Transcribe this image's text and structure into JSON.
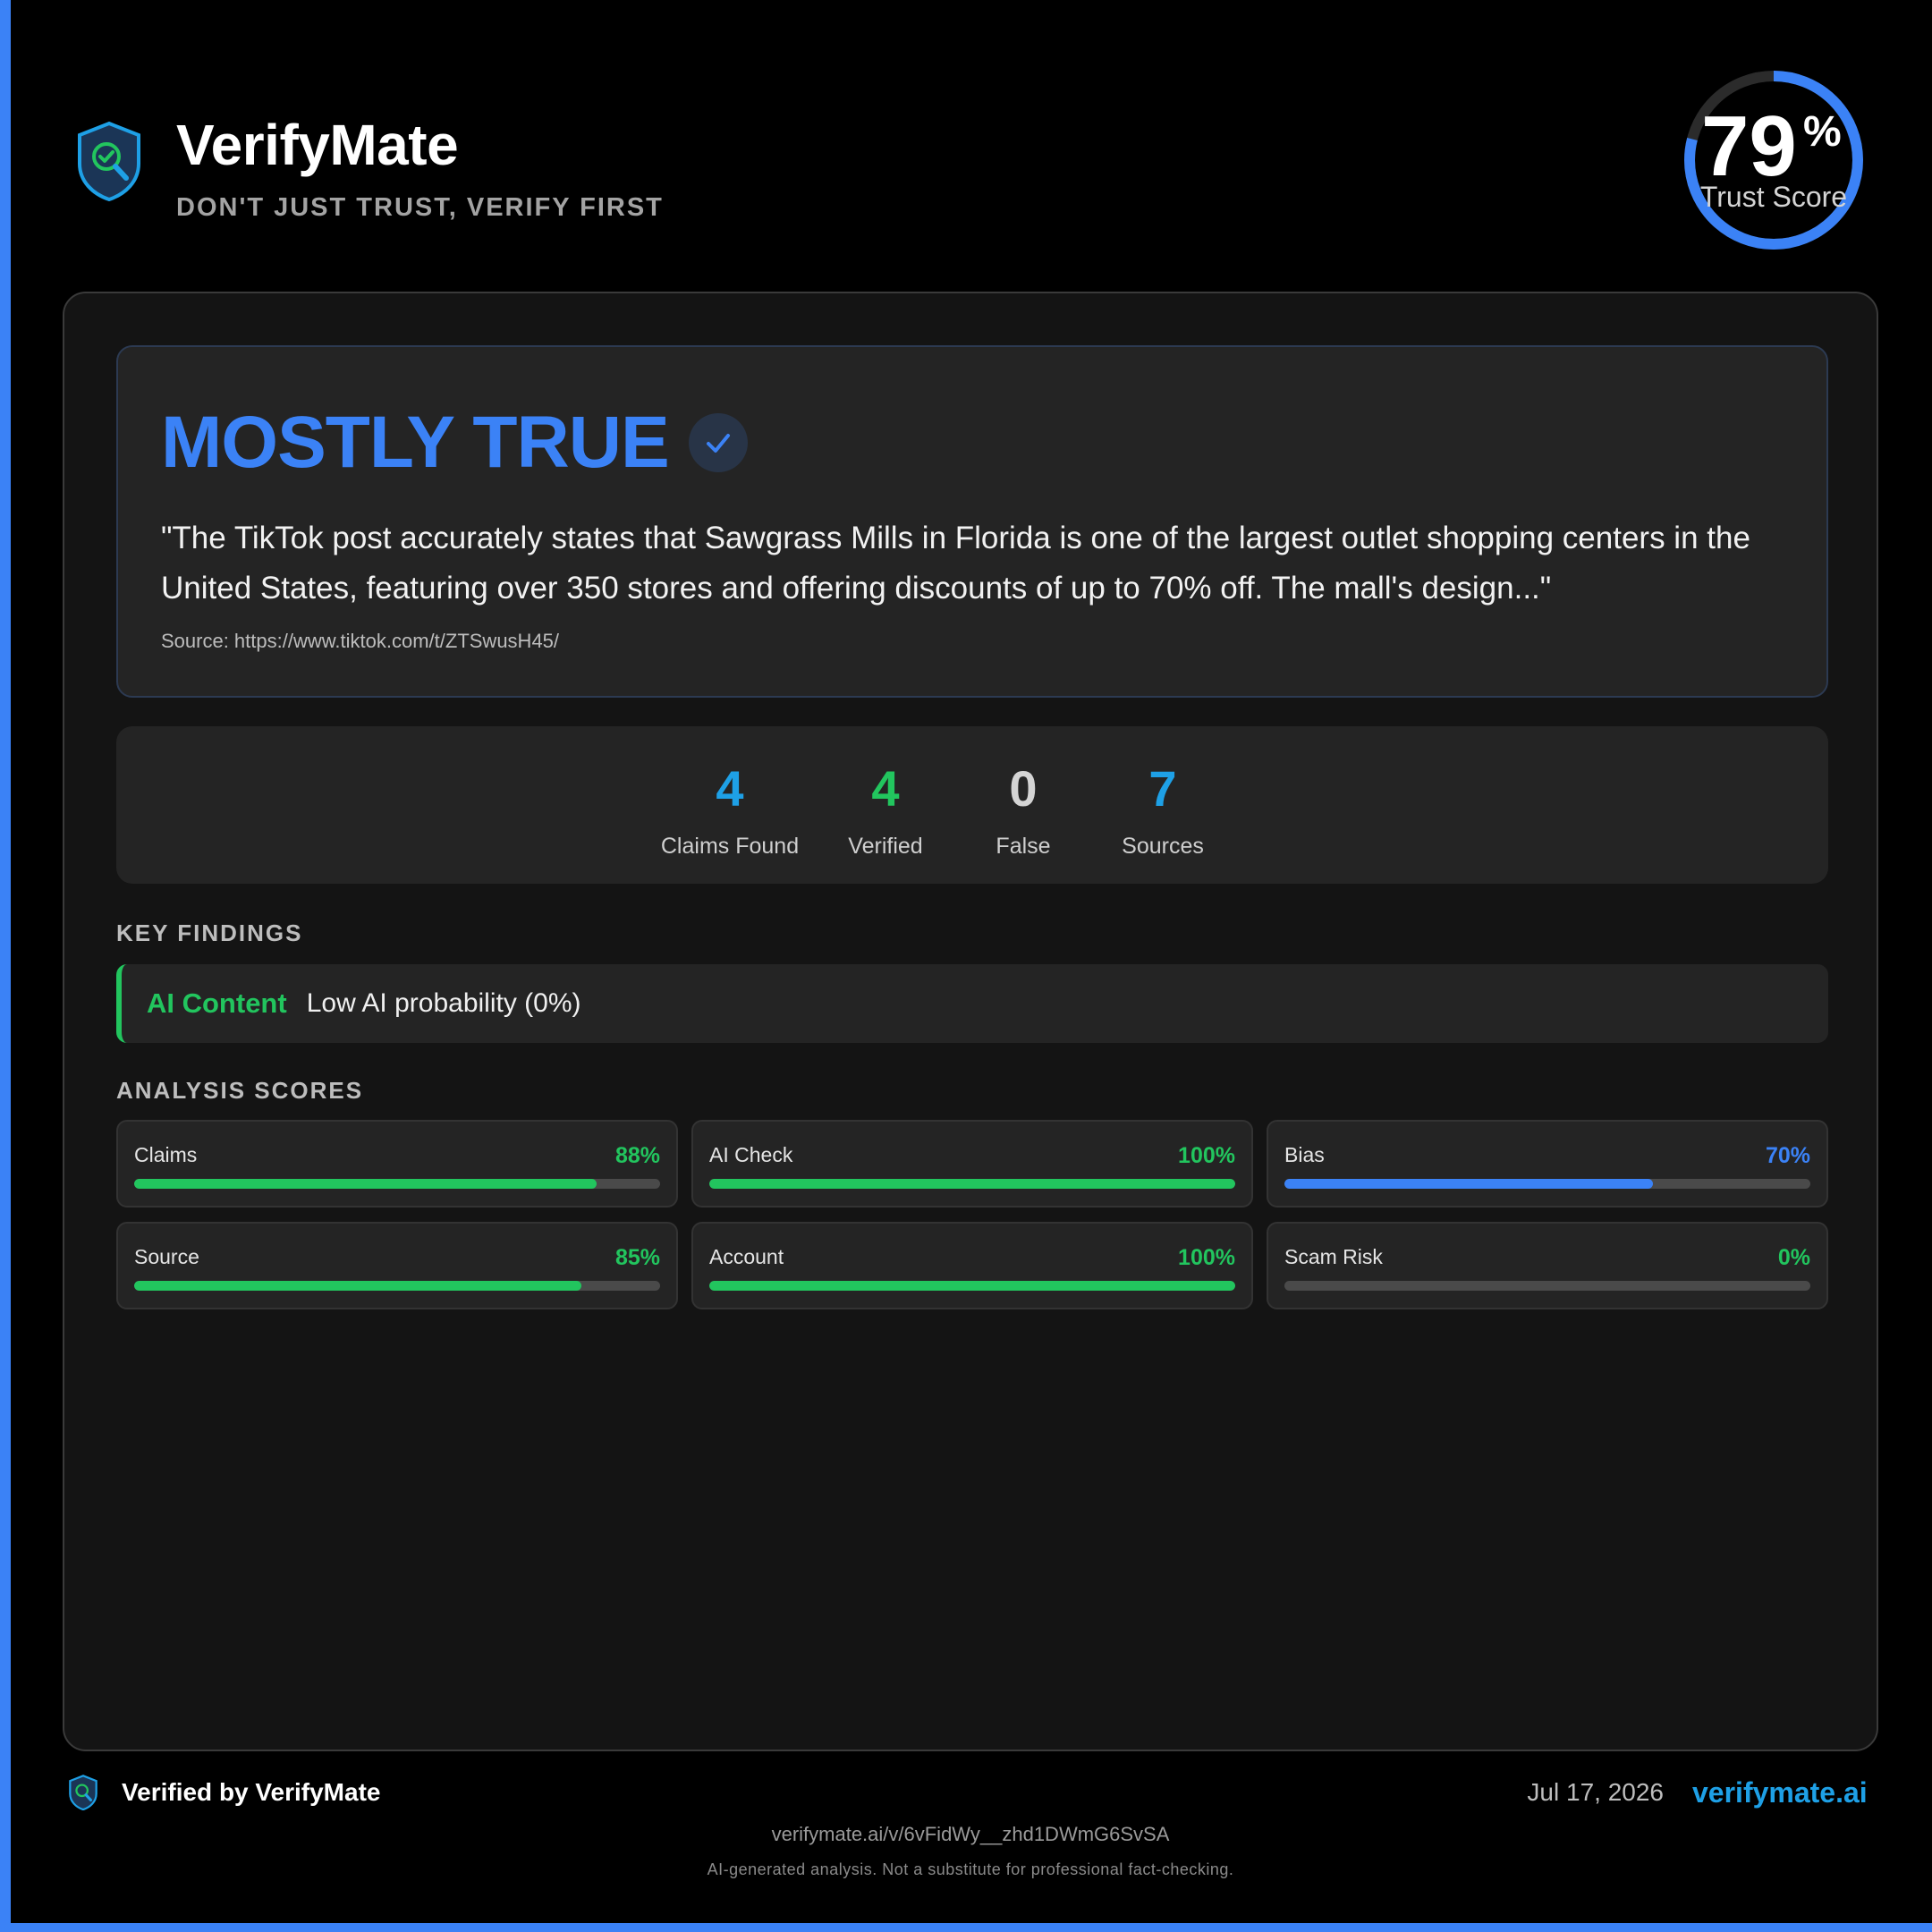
{
  "brand": {
    "name": "VerifyMate",
    "tagline": "DON'T JUST TRUST, VERIFY FIRST"
  },
  "trust_score": {
    "value": "79",
    "unit": "%",
    "label": "Trust Score",
    "fraction": 0.79
  },
  "verdict": {
    "title": "MOSTLY TRUE",
    "icon": "check-icon",
    "quote": "\"The TikTok post accurately states that Sawgrass Mills in Florida is one of the largest outlet shopping centers in the United States, featuring over 350 stores and offering discounts of up to 70% off. The mall's design...\"",
    "source": "Source: https://www.tiktok.com/t/ZTSwusH45/"
  },
  "stats": [
    {
      "value": "4",
      "label": "Claims Found",
      "color": "#1ea0e6"
    },
    {
      "value": "4",
      "label": "Verified",
      "color": "#22c55e"
    },
    {
      "value": "0",
      "label": "False",
      "color": "#d4d4d4"
    },
    {
      "value": "7",
      "label": "Sources",
      "color": "#1ea0e6"
    }
  ],
  "key_findings": {
    "heading": "KEY FINDINGS",
    "items": [
      {
        "tag": "AI Content",
        "text": "Low AI probability (0%)",
        "color": "#22c55e"
      }
    ]
  },
  "analysis_scores": {
    "heading": "ANALYSIS SCORES",
    "items": [
      {
        "name": "Claims",
        "value": "88%",
        "fraction": 0.88,
        "color": "#22c55e"
      },
      {
        "name": "AI Check",
        "value": "100%",
        "fraction": 1.0,
        "color": "#22c55e"
      },
      {
        "name": "Bias",
        "value": "70%",
        "fraction": 0.7,
        "color": "#3b82f6"
      },
      {
        "name": "Source",
        "value": "85%",
        "fraction": 0.85,
        "color": "#22c55e"
      },
      {
        "name": "Account",
        "value": "100%",
        "fraction": 1.0,
        "color": "#22c55e"
      },
      {
        "name": "Scam Risk",
        "value": "0%",
        "fraction": 0.0,
        "color": "#22c55e"
      }
    ]
  },
  "footer": {
    "verified_by": "Verified by VerifyMate",
    "date": "Jul 17, 2026",
    "site": "verifymate.ai",
    "share_url": "verifymate.ai/v/6vFidWy__zhd1DWmG6SvSA",
    "disclaimer": "AI-generated analysis. Not a substitute for professional fact-checking."
  },
  "colors": {
    "accent": "#3b82f6",
    "success": "#22c55e",
    "link": "#1ea0e6"
  }
}
